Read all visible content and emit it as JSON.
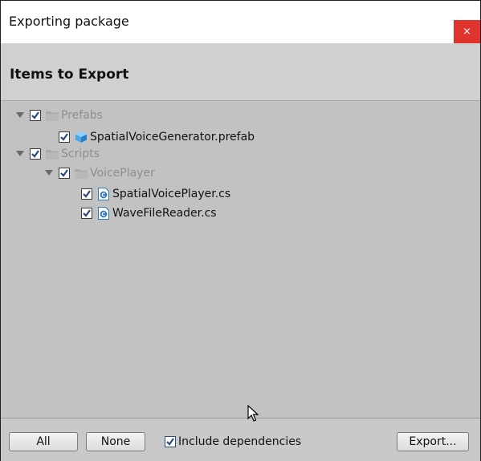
{
  "window": {
    "title": "Exporting package",
    "close_label": "×"
  },
  "header": {
    "title": "Items to Export"
  },
  "tree": {
    "items": [
      {
        "label": "Prefabs",
        "type": "folder",
        "depth": 0,
        "checked": true,
        "expanded": true
      },
      {
        "label": "SpatialVoiceGenerator.prefab",
        "type": "prefab",
        "depth": 1,
        "checked": true
      },
      {
        "label": "Scripts",
        "type": "folder",
        "depth": 0,
        "checked": true,
        "expanded": true
      },
      {
        "label": "VoicePlayer",
        "type": "folder",
        "depth": 1,
        "checked": true,
        "expanded": true
      },
      {
        "label": "SpatialVoicePlayer.cs",
        "type": "script",
        "depth": 2,
        "checked": true
      },
      {
        "label": "WaveFileReader.cs",
        "type": "script",
        "depth": 2,
        "checked": true
      }
    ]
  },
  "footer": {
    "all_label": "All",
    "none_label": "None",
    "include_dependencies_label": "Include dependencies",
    "include_dependencies_checked": true,
    "export_label": "Export..."
  },
  "colors": {
    "panel_bg": "#c2c2c2",
    "close_red": "#e0332d",
    "folder_text": "#8e8e8e",
    "check_blue": "#2c4a7a",
    "script_icon_blue": "#2f78c4",
    "prefab_icon_blue": "#4aa8e8"
  }
}
